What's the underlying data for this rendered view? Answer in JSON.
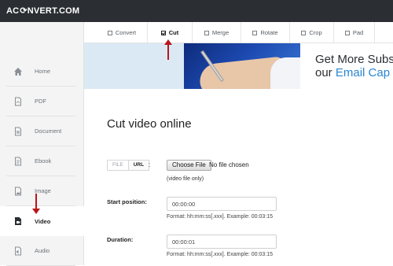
{
  "header": {
    "logo_part1": "AC",
    "logo_part2": "NVERT.COM"
  },
  "sidebar": {
    "items": [
      {
        "label": "Home",
        "icon": "home-icon"
      },
      {
        "label": "PDF",
        "icon": "pdf-icon"
      },
      {
        "label": "Document",
        "icon": "document-icon"
      },
      {
        "label": "Ebook",
        "icon": "ebook-icon"
      },
      {
        "label": "Image",
        "icon": "image-icon"
      },
      {
        "label": "Video",
        "icon": "video-icon"
      },
      {
        "label": "Audio",
        "icon": "audio-icon"
      }
    ],
    "active_index": 5
  },
  "tabs": {
    "items": [
      "Convert",
      "Cut",
      "Merge",
      "Rotate",
      "Crop",
      "Pad"
    ],
    "active_index": 1
  },
  "banner": {
    "line1": "Get More Subsc",
    "line2_plain": "our ",
    "line2_accent": "Email Cap"
  },
  "main": {
    "title": "Cut video online",
    "source_toggle": {
      "file": "FILE",
      "url": "URL",
      "colon": ":"
    },
    "choose_file_label": "Choose File",
    "file_status": "No file chosen",
    "file_note": "(video file only)",
    "start": {
      "label": "Start position:",
      "value": "00:00:00",
      "hint": "Format: hh:mm:ss[.xxx]. Example: 00:03:15"
    },
    "duration": {
      "label": "Duration:",
      "value": "00:00:01",
      "hint": "Format: hh:mm:ss[.xxx]. Example: 00:03:15"
    }
  },
  "colors": {
    "topbar": "#2b2f33",
    "accent": "#2a86d1",
    "annotation_arrow": "#b9151b"
  }
}
